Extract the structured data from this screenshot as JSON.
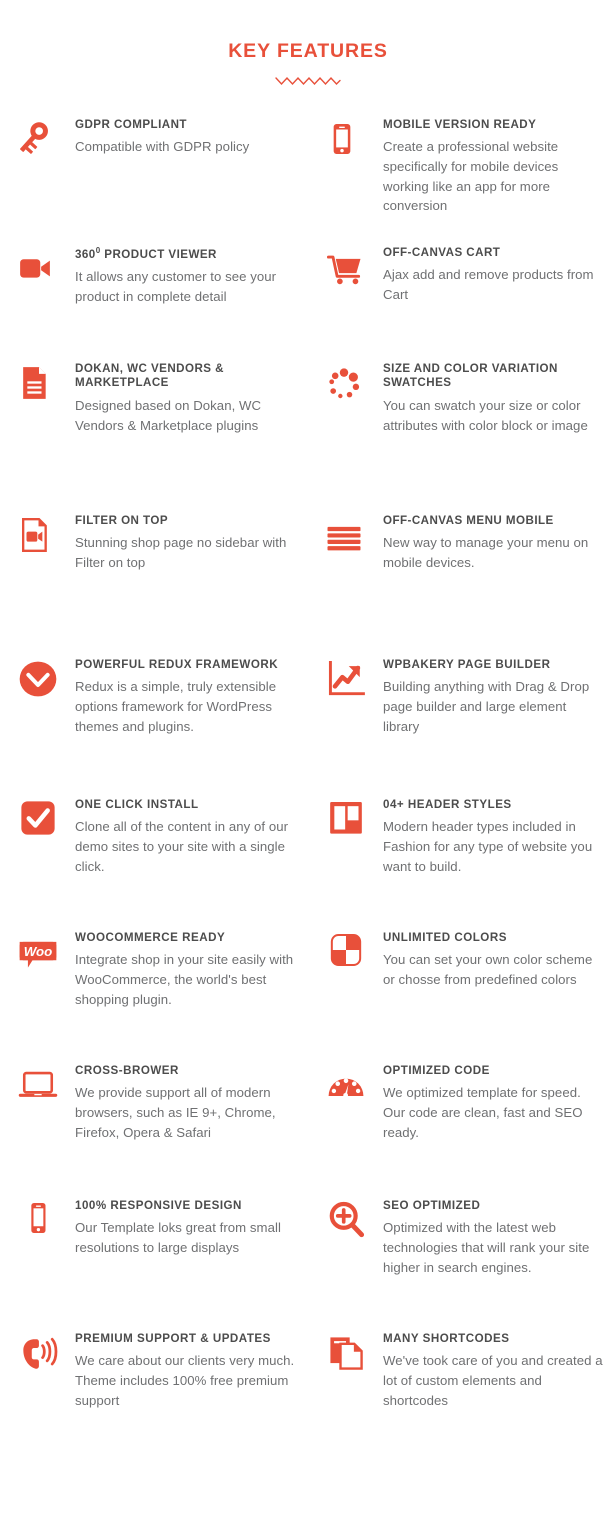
{
  "header": {
    "title": "KEY FEATURES",
    "divider_icon": "wavy-divider",
    "accent_color": "#E8503A",
    "title_color": "#E8503A"
  },
  "colors": {
    "accent": "#E8503A",
    "heading_text": "#4c4c4c",
    "body_text": "#6f7072",
    "background": "#ffffff"
  },
  "sections": [
    {
      "name": "primary-features",
      "rows": [
        {
          "left": {
            "icon": "key-icon",
            "title": "GDPR COMPLIANT",
            "desc": "Compatible with GDPR policy"
          },
          "right": {
            "icon": "mobile-phone-icon",
            "title": "MOBILE VERSION READY",
            "desc": "Create a professional website specifically for mobile devices working like an app for more conversion"
          }
        },
        {
          "left": {
            "icon": "video-camera-icon",
            "title": "360⁰  PRODUCT VIEWER",
            "title_main": "360",
            "title_sup": "0",
            "title_rest": " PRODUCT VIEWER",
            "desc": "It allows any customer to see your product in complete detail"
          },
          "right": {
            "icon": "shopping-cart-icon",
            "title": "OFF-CANVAS CART",
            "desc": "Ajax add and remove products from Cart"
          }
        },
        {
          "left": {
            "icon": "document-lines-icon",
            "title": "DOKAN, WC VENDORS & MARKETPLACE",
            "desc": "Designed based on Dokan, WC Vendors & Marketplace plugins"
          },
          "right": {
            "icon": "color-swatch-dots-icon",
            "title": "SIZE AND COLOR VARIATION SWATCHES",
            "desc": "You can swatch your size or color attributes with color block or image"
          }
        },
        {
          "left": {
            "icon": "video-file-icon",
            "title": "FILTER ON TOP",
            "desc": "Stunning shop page no sidebar with Filter on top"
          },
          "right": {
            "icon": "hamburger-menu-icon",
            "title": "OFF-CANVAS MENU MOBILE",
            "desc": "New way to manage your menu on mobile devices."
          }
        }
      ]
    },
    {
      "name": "secondary-features",
      "rows": [
        {
          "left": {
            "icon": "redux-chevron-circle-icon",
            "title": "POWERFUL REDUX FRAMEWORK",
            "desc": "Redux is a simple, truly extensible options framework for WordPress themes and plugins."
          },
          "right": {
            "icon": "growth-chart-icon",
            "title": "WPBAKERY PAGE BUILDER",
            "desc": "Building anything with Drag & Drop page builder and large element library"
          }
        },
        {
          "left": {
            "icon": "check-square-icon",
            "title": "ONE CLICK INSTALL",
            "desc": "Clone all of the content in any of our demo sites to your site with a single click."
          },
          "right": {
            "icon": "header-layout-icon",
            "title": "04+ HEADER STYLES",
            "desc": "Modern header types included in Fashion for any type of website you want to build."
          }
        },
        {
          "left": {
            "icon": "woocommerce-logo-icon",
            "title": "WOOCOMMERCE READY",
            "desc": "Integrate shop in your site easily with WooCommerce, the world's best shopping plugin."
          },
          "right": {
            "icon": "checker-colors-icon",
            "title": "UNLIMITED COLORS",
            "desc": "You can set your own color scheme or chosse from predefined colors"
          }
        },
        {
          "left": {
            "icon": "laptop-icon",
            "title": "CROSS-BROWER",
            "desc": "We provide support all of modern browsers, such as IE 9+, Chrome, Firefox, Opera & Safari"
          },
          "right": {
            "icon": "speedometer-icon",
            "title": "OPTIMIZED CODE",
            "desc": "We optimized template for speed. Our code are clean, fast and SEO ready."
          }
        },
        {
          "left": {
            "icon": "smartphone-icon",
            "title": "100% RESPONSIVE DESIGN",
            "desc": "Our Template loks great from small resolutions to large displays"
          },
          "right": {
            "icon": "magnifier-plus-icon",
            "title": "SEO OPTIMIZED",
            "desc": "Optimized with the latest web technologies that will rank your site higher in search engines."
          }
        },
        {
          "left": {
            "icon": "phone-ringing-icon",
            "title": "PREMIUM SUPPORT & UPDATES",
            "desc": "We care about our clients very much. Theme includes 100% free premium support"
          },
          "right": {
            "icon": "copy-documents-icon",
            "title": "MANY SHORTCODES",
            "desc": "We've took care of you and created a lot of custom elements and shortcodes"
          }
        }
      ]
    }
  ]
}
